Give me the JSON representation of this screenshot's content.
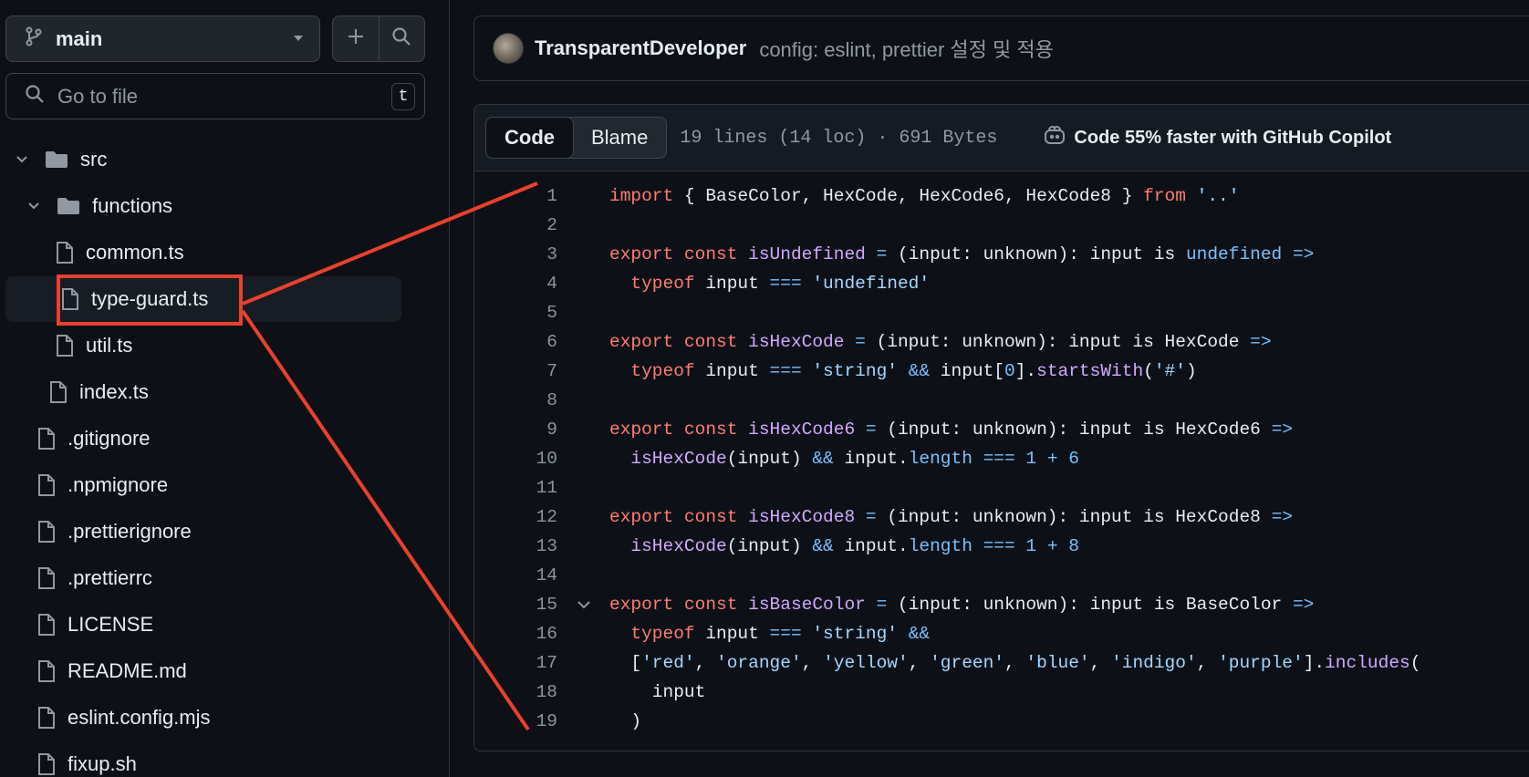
{
  "sidebar": {
    "branch": "main",
    "goto_placeholder": "Go to file",
    "goto_shortcut": "t",
    "tree": [
      {
        "name": "src",
        "type": "folder",
        "depth": 0,
        "expanded": true
      },
      {
        "name": "functions",
        "type": "folder",
        "depth": 1,
        "expanded": true
      },
      {
        "name": "common.ts",
        "type": "file",
        "depth": 2
      },
      {
        "name": "type-guard.ts",
        "type": "file",
        "depth": 2,
        "selected": true
      },
      {
        "name": "util.ts",
        "type": "file",
        "depth": 2
      },
      {
        "name": "index.ts",
        "type": "file",
        "depth": 1
      },
      {
        "name": ".gitignore",
        "type": "file",
        "depth": 0
      },
      {
        "name": ".npmignore",
        "type": "file",
        "depth": 0
      },
      {
        "name": ".prettierignore",
        "type": "file",
        "depth": 0
      },
      {
        "name": ".prettierrc",
        "type": "file",
        "depth": 0
      },
      {
        "name": "LICENSE",
        "type": "file",
        "depth": 0
      },
      {
        "name": "README.md",
        "type": "file",
        "depth": 0
      },
      {
        "name": "eslint.config.mjs",
        "type": "file",
        "depth": 0
      },
      {
        "name": "fixup.sh",
        "type": "file",
        "depth": 0
      }
    ]
  },
  "commit": {
    "author": "TransparentDeveloper",
    "message": "config: eslint, prettier 설정 및 적용"
  },
  "file_header": {
    "code_tab": "Code",
    "blame_tab": "Blame",
    "meta": "19 lines (14 loc) · 691 Bytes",
    "copilot": "Code 55% faster with GitHub Copilot"
  },
  "colors": {
    "keyword": "#ff7b72",
    "function": "#d2a8ff",
    "string": "#a5d6ff",
    "constant": "#79c0ff",
    "annotation": "#e8412e"
  },
  "code": [
    {
      "n": "1",
      "tokens": [
        [
          "k",
          "import"
        ],
        [
          "p",
          " { BaseColor, HexCode, HexCode6, HexCode8 } "
        ],
        [
          "k",
          "from"
        ],
        [
          "p",
          " "
        ],
        [
          "s",
          "'..'"
        ]
      ]
    },
    {
      "n": "2",
      "tokens": []
    },
    {
      "n": "3",
      "tokens": [
        [
          "k",
          "export"
        ],
        [
          "p",
          " "
        ],
        [
          "k",
          "const"
        ],
        [
          "p",
          " "
        ],
        [
          "f",
          "isUndefined"
        ],
        [
          "p",
          " "
        ],
        [
          "c",
          "="
        ],
        [
          "p",
          " (input: unknown): input is "
        ],
        [
          "c",
          "undefined"
        ],
        [
          "p",
          " "
        ],
        [
          "c",
          "=>"
        ]
      ]
    },
    {
      "n": "4",
      "tokens": [
        [
          "p",
          "  "
        ],
        [
          "k",
          "typeof"
        ],
        [
          "p",
          " input "
        ],
        [
          "c",
          "==="
        ],
        [
          "p",
          " "
        ],
        [
          "s",
          "'undefined'"
        ]
      ]
    },
    {
      "n": "5",
      "tokens": []
    },
    {
      "n": "6",
      "tokens": [
        [
          "k",
          "export"
        ],
        [
          "p",
          " "
        ],
        [
          "k",
          "const"
        ],
        [
          "p",
          " "
        ],
        [
          "f",
          "isHexCode"
        ],
        [
          "p",
          " "
        ],
        [
          "c",
          "="
        ],
        [
          "p",
          " (input: unknown): input is HexCode "
        ],
        [
          "c",
          "=>"
        ]
      ]
    },
    {
      "n": "7",
      "tokens": [
        [
          "p",
          "  "
        ],
        [
          "k",
          "typeof"
        ],
        [
          "p",
          " input "
        ],
        [
          "c",
          "==="
        ],
        [
          "p",
          " "
        ],
        [
          "s",
          "'string'"
        ],
        [
          "p",
          " "
        ],
        [
          "c",
          "&&"
        ],
        [
          "p",
          " input["
        ],
        [
          "c",
          "0"
        ],
        [
          "p",
          "]."
        ],
        [
          "f",
          "startsWith"
        ],
        [
          "p",
          "("
        ],
        [
          "s",
          "'#'"
        ],
        [
          "p",
          ")"
        ]
      ]
    },
    {
      "n": "8",
      "tokens": []
    },
    {
      "n": "9",
      "tokens": [
        [
          "k",
          "export"
        ],
        [
          "p",
          " "
        ],
        [
          "k",
          "const"
        ],
        [
          "p",
          " "
        ],
        [
          "f",
          "isHexCode6"
        ],
        [
          "p",
          " "
        ],
        [
          "c",
          "="
        ],
        [
          "p",
          " (input: unknown): input is HexCode6 "
        ],
        [
          "c",
          "=>"
        ]
      ]
    },
    {
      "n": "10",
      "tokens": [
        [
          "p",
          "  "
        ],
        [
          "f",
          "isHexCode"
        ],
        [
          "p",
          "(input) "
        ],
        [
          "c",
          "&&"
        ],
        [
          "p",
          " input."
        ],
        [
          "c",
          "length"
        ],
        [
          "p",
          " "
        ],
        [
          "c",
          "==="
        ],
        [
          "p",
          " "
        ],
        [
          "c",
          "1"
        ],
        [
          "p",
          " "
        ],
        [
          "c",
          "+"
        ],
        [
          "p",
          " "
        ],
        [
          "c",
          "6"
        ]
      ]
    },
    {
      "n": "11",
      "tokens": []
    },
    {
      "n": "12",
      "tokens": [
        [
          "k",
          "export"
        ],
        [
          "p",
          " "
        ],
        [
          "k",
          "const"
        ],
        [
          "p",
          " "
        ],
        [
          "f",
          "isHexCode8"
        ],
        [
          "p",
          " "
        ],
        [
          "c",
          "="
        ],
        [
          "p",
          " (input: unknown): input is HexCode8 "
        ],
        [
          "c",
          "=>"
        ]
      ]
    },
    {
      "n": "13",
      "tokens": [
        [
          "p",
          "  "
        ],
        [
          "f",
          "isHexCode"
        ],
        [
          "p",
          "(input) "
        ],
        [
          "c",
          "&&"
        ],
        [
          "p",
          " input."
        ],
        [
          "c",
          "length"
        ],
        [
          "p",
          " "
        ],
        [
          "c",
          "==="
        ],
        [
          "p",
          " "
        ],
        [
          "c",
          "1"
        ],
        [
          "p",
          " "
        ],
        [
          "c",
          "+"
        ],
        [
          "p",
          " "
        ],
        [
          "c",
          "8"
        ]
      ]
    },
    {
      "n": "14",
      "tokens": []
    },
    {
      "n": "15",
      "fold": true,
      "tokens": [
        [
          "k",
          "export"
        ],
        [
          "p",
          " "
        ],
        [
          "k",
          "const"
        ],
        [
          "p",
          " "
        ],
        [
          "f",
          "isBaseColor"
        ],
        [
          "p",
          " "
        ],
        [
          "c",
          "="
        ],
        [
          "p",
          " (input: unknown): input is BaseColor "
        ],
        [
          "c",
          "=>"
        ]
      ]
    },
    {
      "n": "16",
      "tokens": [
        [
          "p",
          "  "
        ],
        [
          "k",
          "typeof"
        ],
        [
          "p",
          " input "
        ],
        [
          "c",
          "==="
        ],
        [
          "p",
          " "
        ],
        [
          "s",
          "'string'"
        ],
        [
          "p",
          " "
        ],
        [
          "c",
          "&&"
        ]
      ]
    },
    {
      "n": "17",
      "tokens": [
        [
          "p",
          "  ["
        ],
        [
          "s",
          "'red'"
        ],
        [
          "p",
          ", "
        ],
        [
          "s",
          "'orange'"
        ],
        [
          "p",
          ", "
        ],
        [
          "s",
          "'yellow'"
        ],
        [
          "p",
          ", "
        ],
        [
          "s",
          "'green'"
        ],
        [
          "p",
          ", "
        ],
        [
          "s",
          "'blue'"
        ],
        [
          "p",
          ", "
        ],
        [
          "s",
          "'indigo'"
        ],
        [
          "p",
          ", "
        ],
        [
          "s",
          "'purple'"
        ],
        [
          "p",
          "]."
        ],
        [
          "f",
          "includes"
        ],
        [
          "p",
          "("
        ]
      ]
    },
    {
      "n": "18",
      "tokens": [
        [
          "p",
          "    input"
        ]
      ]
    },
    {
      "n": "19",
      "tokens": [
        [
          "p",
          "  )"
        ]
      ]
    }
  ]
}
